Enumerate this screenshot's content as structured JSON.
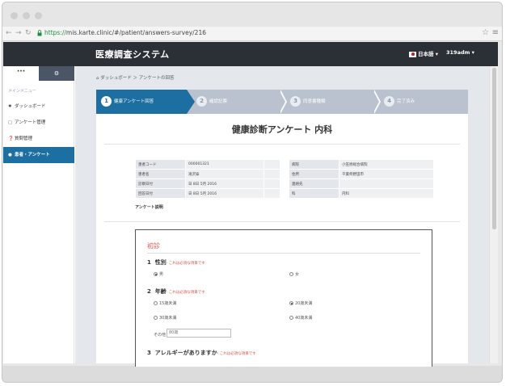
{
  "browser": {
    "url_scheme": "https://",
    "url_rest": "mis.karte.clinic/#/patient/answers-survey/216"
  },
  "header": {
    "title": "医療調査システム",
    "language": "日本語 ▾",
    "user": "319adm ▾"
  },
  "sidebar": {
    "tab_a": "···",
    "tab_b": "⚙",
    "section": "メインメニュー",
    "items": [
      {
        "label": "ダッシュボード",
        "icon": "dashboard-icon"
      },
      {
        "label": "アンケート管理",
        "icon": "calendar-icon"
      },
      {
        "label": "質問管理",
        "icon": "question-icon"
      },
      {
        "label": "患者・アンケート",
        "icon": "user-icon"
      }
    ]
  },
  "breadcrumb": "ダッシュボード ＞ アンケートの回答",
  "steps": [
    {
      "num": "1",
      "label": "健康アンケート回答"
    },
    {
      "num": "2",
      "label": "確認記票"
    },
    {
      "num": "3",
      "label": "同意書種類"
    },
    {
      "num": "4",
      "label": "完了済み"
    }
  ],
  "card": {
    "title": "健康診断アンケート 内科",
    "left_table": [
      [
        "患者コード",
        "000001321"
      ],
      [
        "患者名",
        "滝沢泰"
      ],
      [
        "診察日付",
        "日 8日 5月 2016"
      ],
      [
        "回答日付",
        "日 8日 5月 2016"
      ]
    ],
    "right_table": [
      [
        "病院",
        "小笠原総合病院"
      ],
      [
        "住所",
        "千葉県野田市"
      ],
      [
        "連絡先",
        ""
      ],
      [
        "科",
        "内科"
      ]
    ],
    "description_label": "アンケート説明"
  },
  "survey": {
    "heading": "初診",
    "required_note": "- これは必須な項目です",
    "q1": {
      "number": "1",
      "label": "性別",
      "options": [
        "男",
        "女"
      ],
      "selected": "男"
    },
    "q2": {
      "number": "2",
      "label": "年齢",
      "options": [
        "15歳未満",
        "20歳未満",
        "30歳未満",
        "40歳未満"
      ],
      "selected": "20歳未満"
    },
    "other_label": "その他",
    "other_value": "80歳",
    "q3": {
      "number": "3",
      "label": "アレルギーがありますか"
    }
  },
  "colors": {
    "accent": "#1c6fa0",
    "topnav": "#2b2f36",
    "required": "#d9534f"
  }
}
